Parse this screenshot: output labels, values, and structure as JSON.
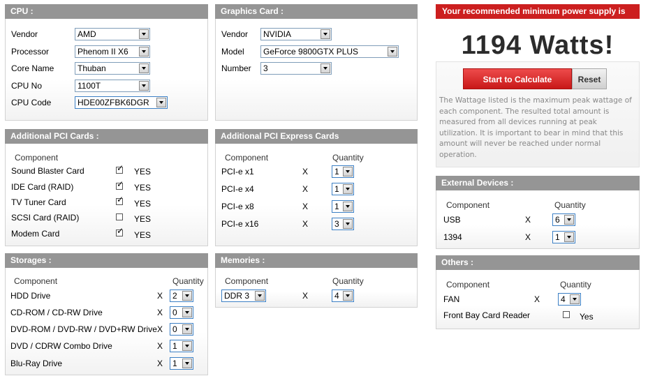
{
  "cpu": {
    "title": "CPU :",
    "vendor_label": "Vendor",
    "vendor_value": "AMD",
    "processor_label": "Processor",
    "processor_value": "Phenom II X6",
    "core_label": "Core Name",
    "core_value": "Thuban",
    "cpuno_label": "CPU No",
    "cpuno_value": "1100T",
    "code_label": "CPU Code",
    "code_value": "HDE00ZFBK6DGR"
  },
  "gpu": {
    "title": "Graphics Card :",
    "vendor_label": "Vendor",
    "vendor_value": "NVIDIA",
    "model_label": "Model",
    "model_value": "GeForce 9800GTX PLUS",
    "number_label": "Number",
    "number_value": "3"
  },
  "power": {
    "header": "Your recommended minimum power supply is",
    "watts": "1194 Watts!",
    "start_label": "Start to Calculate",
    "reset_label": "Reset",
    "description": "The Wattage listed is the maximum peak wattage of each component. The resulted total amount is measured from all devices running at peak utilization. It is important to bear in mind that this amount will never be reached under normal operation."
  },
  "pci": {
    "title": "Additional PCI Cards :",
    "component_header": "Component",
    "yes_label": "YES",
    "items": [
      {
        "label": "Sound Blaster Card",
        "checked": true
      },
      {
        "label": "IDE Card (RAID)",
        "checked": true
      },
      {
        "label": "TV Tuner Card",
        "checked": true
      },
      {
        "label": "SCSI Card (RAID)",
        "checked": false
      },
      {
        "label": "Modem Card",
        "checked": true
      }
    ]
  },
  "pcie": {
    "title": "Additional PCI Express Cards",
    "component_header": "Component",
    "quantity_header": "Quantity",
    "x_label": "X",
    "items": [
      {
        "label": "PCI-e x1",
        "qty": "1"
      },
      {
        "label": "PCI-e x4",
        "qty": "1"
      },
      {
        "label": "PCI-e x8",
        "qty": "1"
      },
      {
        "label": "PCI-e x16",
        "qty": "3"
      }
    ]
  },
  "external": {
    "title": "External Devices :",
    "component_header": "Component",
    "quantity_header": "Quantity",
    "x_label": "X",
    "items": [
      {
        "label": "USB",
        "qty": "6"
      },
      {
        "label": "1394",
        "qty": "1"
      }
    ]
  },
  "others": {
    "title": "Others :",
    "component_header": "Component",
    "quantity_header": "Quantity",
    "x_label": "X",
    "fan_label": "FAN",
    "fan_qty": "4",
    "reader_label": "Front Bay Card Reader",
    "reader_yes": "Yes",
    "reader_checked": false
  },
  "storages": {
    "title": "Storages :",
    "component_header": "Component",
    "quantity_header": "Quantity",
    "x_label": "X",
    "items": [
      {
        "label": "HDD Drive",
        "qty": "2"
      },
      {
        "label": "CD-ROM / CD-RW Drive",
        "qty": "0"
      },
      {
        "label": "DVD-ROM / DVD-RW / DVD+RW Drive",
        "qty": "0"
      },
      {
        "label": "DVD / CDRW Combo Drive",
        "qty": "1"
      },
      {
        "label": "Blu-Ray Drive",
        "qty": "1"
      }
    ]
  },
  "memories": {
    "title": "Memories :",
    "component_header": "Component",
    "quantity_header": "Quantity",
    "x_label": "X",
    "type_value": "DDR 3",
    "qty": "4"
  }
}
